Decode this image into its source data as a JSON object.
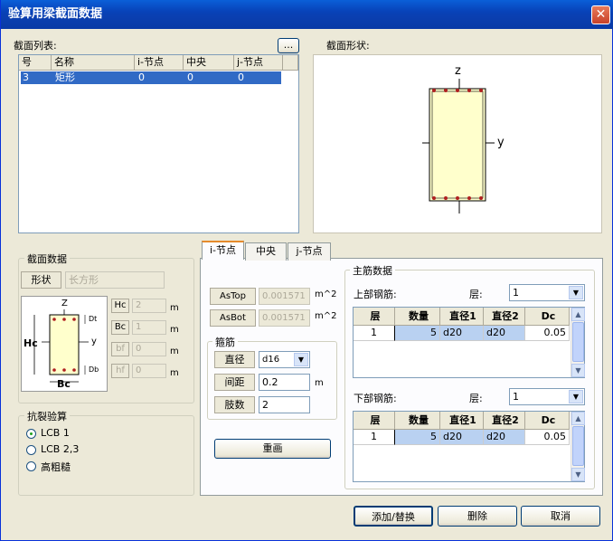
{
  "window": {
    "title": "验算用梁截面数据",
    "close": "✕"
  },
  "section_list": {
    "label": "截面列表:",
    "browse_button": "...",
    "columns": [
      "号",
      "名称",
      "i-节点",
      "中央",
      "j-节点"
    ],
    "rows": [
      {
        "no": "3",
        "name": "矩形",
        "i": "0",
        "mid": "0",
        "j": "0"
      }
    ]
  },
  "section_shape": {
    "label": "截面形状:",
    "z_axis": "z",
    "y_axis": "y"
  },
  "section_data": {
    "group_title": "截面数据",
    "shape_label": "形状",
    "shape_value": "长方形",
    "diagram": {
      "z": "Z",
      "y": "y",
      "Hc": "Hc",
      "Bc": "Bc",
      "Dt": "Dt",
      "Db": "Db"
    },
    "fields": [
      {
        "label": "Hc",
        "value": "2",
        "unit": "m"
      },
      {
        "label": "Bc",
        "value": "1",
        "unit": "m"
      },
      {
        "label": "bf",
        "value": "0",
        "unit": "m"
      },
      {
        "label": "hf",
        "value": "0",
        "unit": "m"
      }
    ]
  },
  "crack_check": {
    "group_title": "抗裂验算",
    "options": [
      "LCB 1",
      "LCB 2,3",
      "高粗糙"
    ],
    "selected": 0
  },
  "tabs": {
    "items": [
      "i-节点",
      "中央",
      "j-节点"
    ],
    "active": 0
  },
  "as_fields": [
    {
      "label": "AsTop",
      "value": "0.001571",
      "unit": "m^2"
    },
    {
      "label": "AsBot",
      "value": "0.001571",
      "unit": "m^2"
    }
  ],
  "stirrup": {
    "group_title": "箍筋",
    "diameter_label": "直径",
    "diameter_value": "d16",
    "spacing_label": "间距",
    "spacing_value": "0.2",
    "spacing_unit": "m",
    "legs_label": "肢数",
    "legs_value": "2"
  },
  "redraw_button": "重画",
  "main_rebar": {
    "group_title": "主筋数据",
    "top": {
      "label": "上部钢筋:",
      "layer_label": "层:",
      "layer_value": "1",
      "columns": [
        "层",
        "数量",
        "直径1",
        "直径2",
        "Dc"
      ],
      "rows": [
        {
          "layer": "1",
          "count": "5",
          "d1": "d20",
          "d2": "d20",
          "dc": "0.05"
        }
      ]
    },
    "bottom": {
      "label": "下部钢筋:",
      "layer_label": "层:",
      "layer_value": "1",
      "columns": [
        "层",
        "数量",
        "直径1",
        "直径2",
        "Dc"
      ],
      "rows": [
        {
          "layer": "1",
          "count": "5",
          "d1": "d20",
          "d2": "d20",
          "dc": "0.05"
        }
      ]
    }
  },
  "buttons": {
    "add_replace": "添加/替换",
    "delete": "删除",
    "cancel": "取消"
  },
  "colors": {
    "title_bar": "#0a4fc8",
    "selection": "#316ac5",
    "section_fill": "#ffffcc",
    "rebar": "#b02020",
    "grid_highlight": "#b9d1f1"
  }
}
